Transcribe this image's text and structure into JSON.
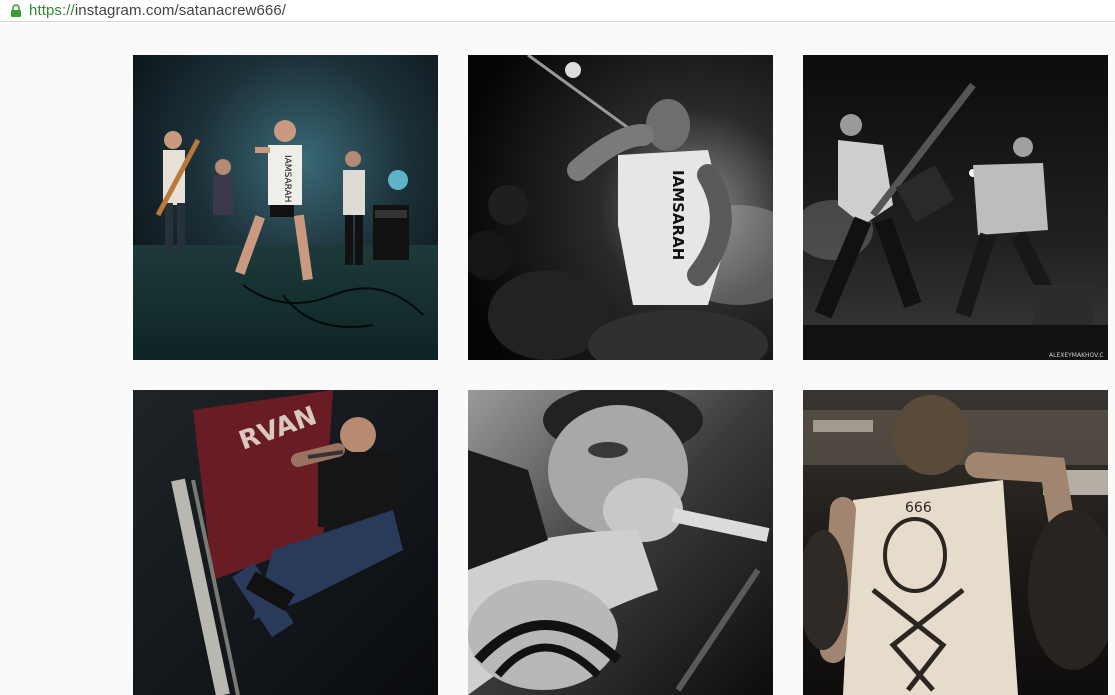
{
  "browser": {
    "url_scheme": "https://",
    "url_rest": "instagram.com/satanacrew666/"
  },
  "photos": [
    {
      "id": "p1",
      "tshirt_text": "IAMSARAH"
    },
    {
      "id": "p2",
      "tshirt_text": "IAMSARAH"
    },
    {
      "id": "p3",
      "watermark": "ALEXEYMAKHOV.C"
    },
    {
      "id": "p4",
      "banner_text": "RVAN"
    },
    {
      "id": "p5"
    },
    {
      "id": "p6",
      "tshirt_text": "666"
    }
  ],
  "colors": {
    "page_bg": "#fafafa",
    "url_green": "#2e8b2e"
  }
}
